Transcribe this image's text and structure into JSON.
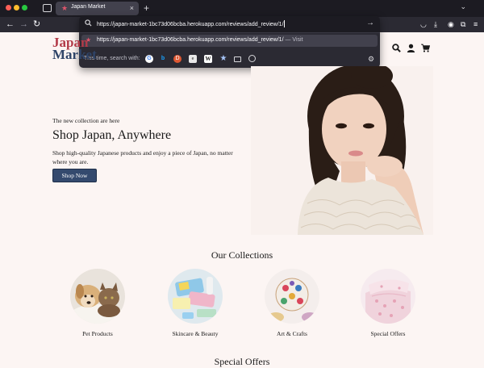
{
  "browser": {
    "tab_title": "Japan Market",
    "tab_close": "×",
    "new_tab": "+",
    "tabs_menu": "⌄",
    "url": "https://japan-market-1bc73d06bcba.herokuapp.com/reviews/add_review/1/",
    "suggestion_url": "https://japan-market-1bc73d06bcba.herokuapp.com/reviews/add_review/1/",
    "suggestion_sep": " — ",
    "suggestion_action": "Visit",
    "search_with_label": "This time, search with:",
    "engines": [
      "G",
      "b",
      "D",
      "e",
      "W"
    ]
  },
  "site": {
    "logo_line1": "Japan",
    "logo_line2": "Market"
  },
  "hero": {
    "kicker": "The new collection are here",
    "title": "Shop Japan, Anywhere",
    "description": "Shop high-quality Japanese products and enjoy a piece of Japan, no matter where you are.",
    "button": "Shop Now"
  },
  "collections": {
    "title": "Our Collections",
    "items": [
      {
        "label": "Pet Products"
      },
      {
        "label": "Skincare & Beauty"
      },
      {
        "label": "Art & Crafts"
      },
      {
        "label": "Special Offers"
      }
    ]
  },
  "special_offers": {
    "title": "Special Offers"
  },
  "colors": {
    "page_bg": "#fcf5f3",
    "primary_button": "#344a6e",
    "logo_red": "#b23a48",
    "logo_navy": "#2f4468",
    "chrome_dark": "#1c1b22"
  }
}
